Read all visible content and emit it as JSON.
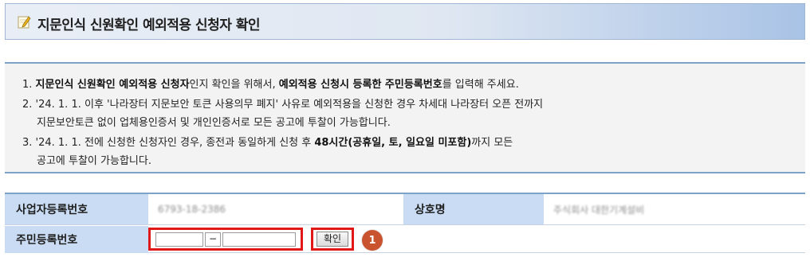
{
  "header": {
    "title": "지문인식 신원확인 예외적용 신청자 확인",
    "icon": "memo-pencil-icon"
  },
  "notice": {
    "line1_prefix": "1. ",
    "line1_b1": "지문인식 신원확인 예외적용 신청자",
    "line1_mid": "인지 확인을 위해서, ",
    "line1_b2": "예외적용 신청시 등록한 주민등록번호",
    "line1_suffix": "를 입력해 주세요.",
    "line2a": "2. '24. 1. 1. 이후 '나라장터 지문보안 토큰 사용의무 폐지' 사유로 예외적용을 신청한 경우 차세대 나라장터 오픈 전까지",
    "line2b": "지문보안토큰 없이 업체용인증서 및 개인인증서로 모든 공고에 투찰이 가능합니다.",
    "line3_prefix": "3. '24. 1. 1. 전에 신청한 신청자인 경우, 종전과 동일하게 신청 후 ",
    "line3_b": "48시간(공휴일, 토, 일요일 미포함)",
    "line3_suffix": "까지 모든",
    "line3b": "공고에 투찰이 가능합니다."
  },
  "form": {
    "biz_reg_label": "사업자등록번호",
    "biz_reg_value": "6793-18-2386",
    "company_label": "상호명",
    "company_value": "주식회사 대한기계설비",
    "rrn_label": "주민등록번호",
    "rrn_front_value": "",
    "rrn_dash": "−",
    "rrn_back_value": "",
    "confirm_label": "확인",
    "step_marker": "1"
  },
  "colors": {
    "highlight_border": "#e01818",
    "header_cell": "#c9dcf3",
    "marker": "#c9532f"
  }
}
